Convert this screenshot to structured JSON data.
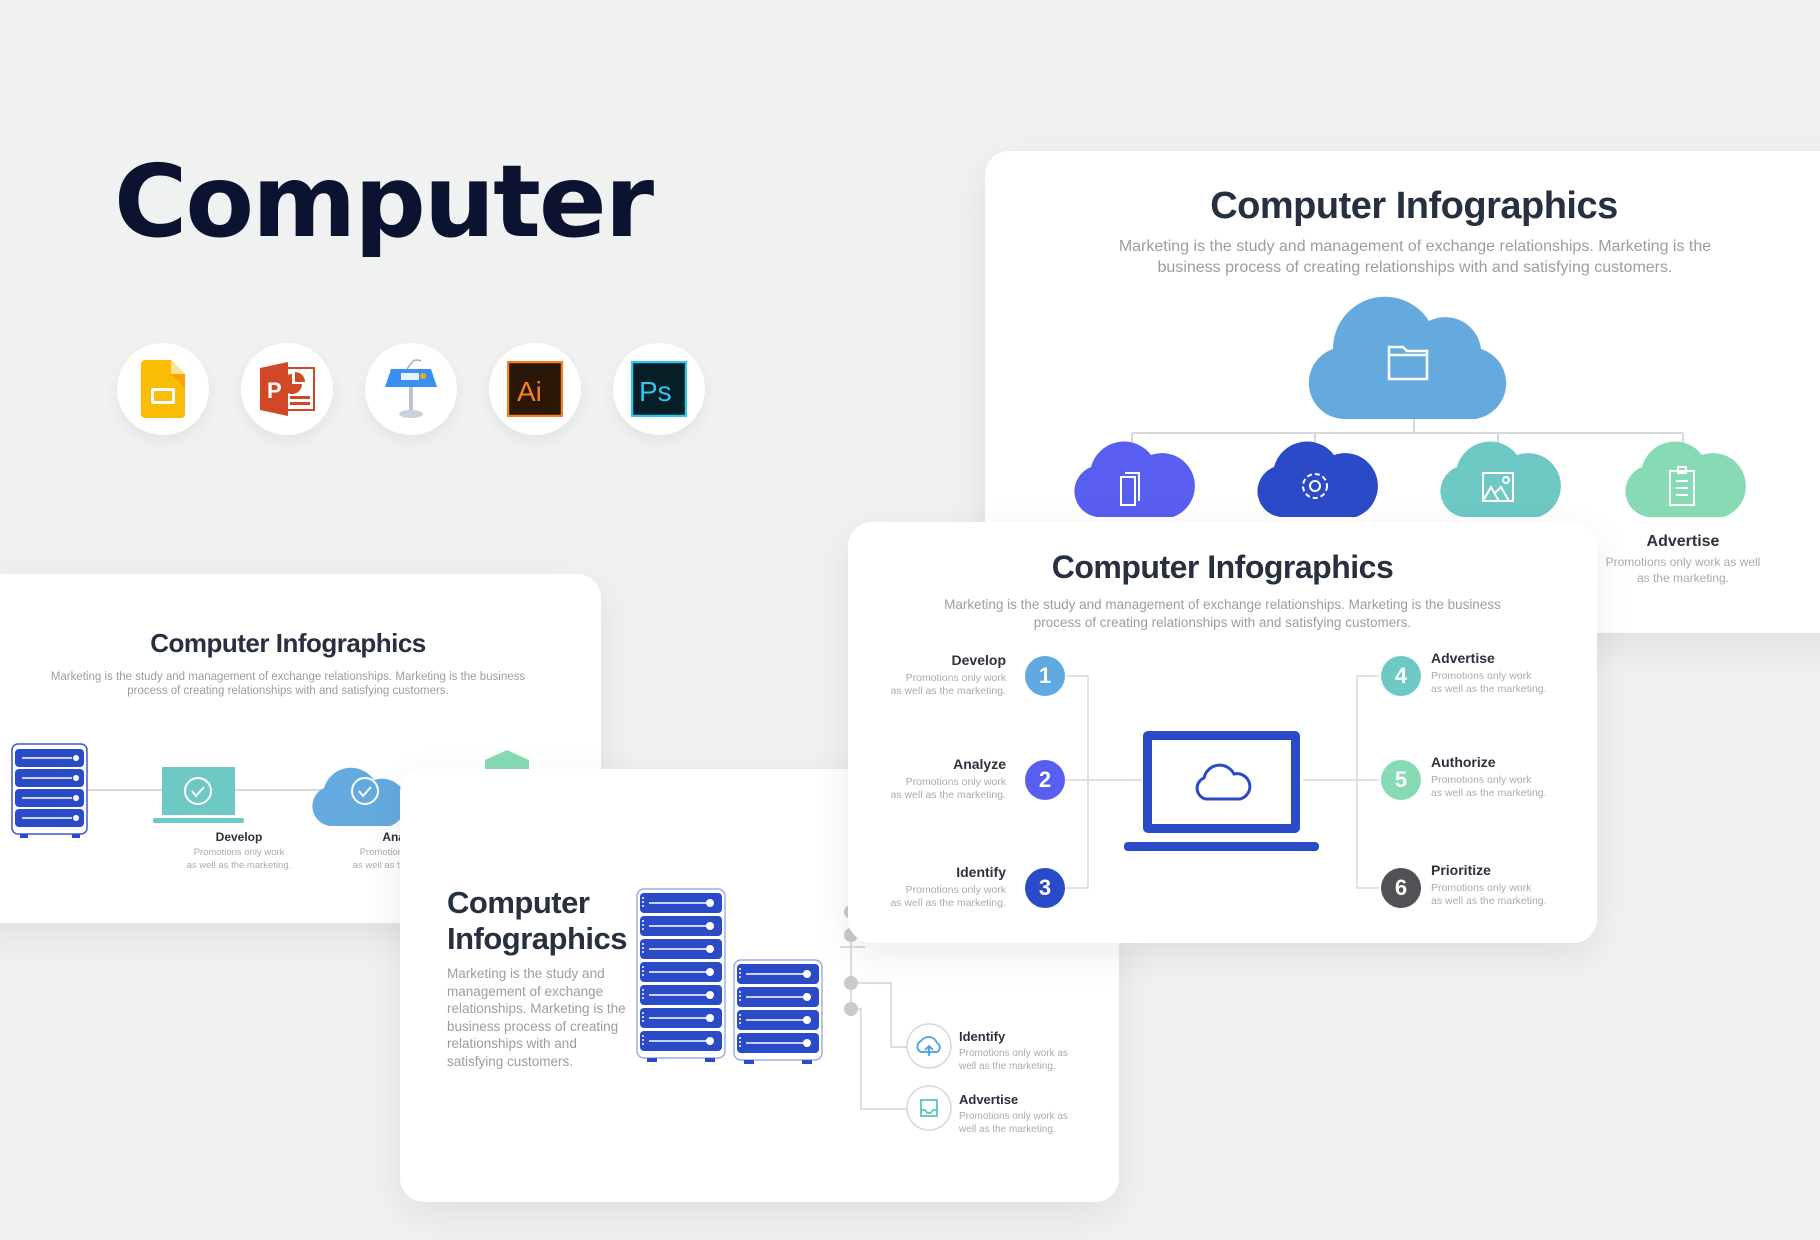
{
  "hero": {
    "title": "Computer",
    "app_icons": [
      {
        "name": "google-slides-icon",
        "label": "Google Slides"
      },
      {
        "name": "powerpoint-icon",
        "label": "PowerPoint"
      },
      {
        "name": "keynote-icon",
        "label": "Keynote"
      },
      {
        "name": "illustrator-icon",
        "label": "Ai"
      },
      {
        "name": "photoshop-icon",
        "label": "Ps"
      }
    ]
  },
  "colors": {
    "background": "#f0f1f1",
    "title": "#0b1331",
    "heading": "#263040",
    "muted": "#a8abb0",
    "blue": "#5fa8e0",
    "indigo": "#575ef0",
    "royal": "#2b4ac8",
    "teal": "#6ec8c4",
    "mint": "#86dbb5",
    "dark": "#505255"
  },
  "slides": {
    "cloud_tree": {
      "title": "Computer Infographics",
      "description": "Marketing is the study and management of exchange relationships. Marketing is the business process of creating relationships with and satisfying customers.",
      "root_icon": "folder-icon",
      "children": [
        {
          "icon": "documents-icon",
          "color": "#575ef0"
        },
        {
          "icon": "gear-icon",
          "color": "#2b4ac8"
        },
        {
          "icon": "image-icon",
          "color": "#6ec8c4"
        },
        {
          "icon": "clipboard-icon",
          "color": "#86dbb5",
          "label": "Advertise",
          "text": "Promotions only work as well as the marketing."
        }
      ]
    },
    "laptop_steps": {
      "title": "Computer Infographics",
      "description": "Marketing is the study and management of exchange relationships. Marketing is the business process of creating relationships with and satisfying customers.",
      "left": [
        {
          "number": "1",
          "label": "Develop",
          "text1": "Promotions only work",
          "text2": "as well as the marketing.",
          "color": "#5fa8e0"
        },
        {
          "number": "2",
          "label": "Analyze",
          "text1": "Promotions only work",
          "text2": "as well as the marketing.",
          "color": "#575ef0"
        },
        {
          "number": "3",
          "label": "Identify",
          "text1": "Promotions only work",
          "text2": "as well as the marketing.",
          "color": "#2b4ac8"
        }
      ],
      "right": [
        {
          "number": "4",
          "label": "Advertise",
          "text1": "Promotions only work",
          "text2": "as well as the marketing.",
          "color": "#6ec8c4"
        },
        {
          "number": "5",
          "label": "Authorize",
          "text1": "Promotions only work",
          "text2": "as well as the marketing.",
          "color": "#86dbb5"
        },
        {
          "number": "6",
          "label": "Prioritize",
          "text1": "Promotions only work",
          "text2": "as well as the marketing.",
          "color": "#505255"
        }
      ]
    },
    "process_flow": {
      "title": "Computer Infographics",
      "description_line1": "Marketing is the study and management of exchange relationships. Marketing is the business",
      "description_line2": "process of creating relationships with and satisfying customers.",
      "steps": [
        {
          "label": "Develop",
          "text1": "Promotions only work",
          "text2": "as well as the marketing."
        },
        {
          "label": "Analyze",
          "text1": "Promotions only work",
          "text2": "as well as the marketing."
        }
      ]
    },
    "server_rack": {
      "title_line1": "Computer",
      "title_line2": "Infographics",
      "description": [
        "Marketing is the study and",
        "management of exchange",
        "relationships. Marketing is the",
        "business process of creating",
        "relationships with and",
        "satisfying customers."
      ],
      "items": [
        {
          "label": "Identify",
          "icon": "cloud-upload-icon",
          "text1": "Promotions only work as",
          "text2": "well as the marketing."
        },
        {
          "label": "Advertise",
          "icon": "inbox-icon",
          "text1": "Promotions only work as",
          "text2": "well as the marketing."
        }
      ]
    }
  }
}
